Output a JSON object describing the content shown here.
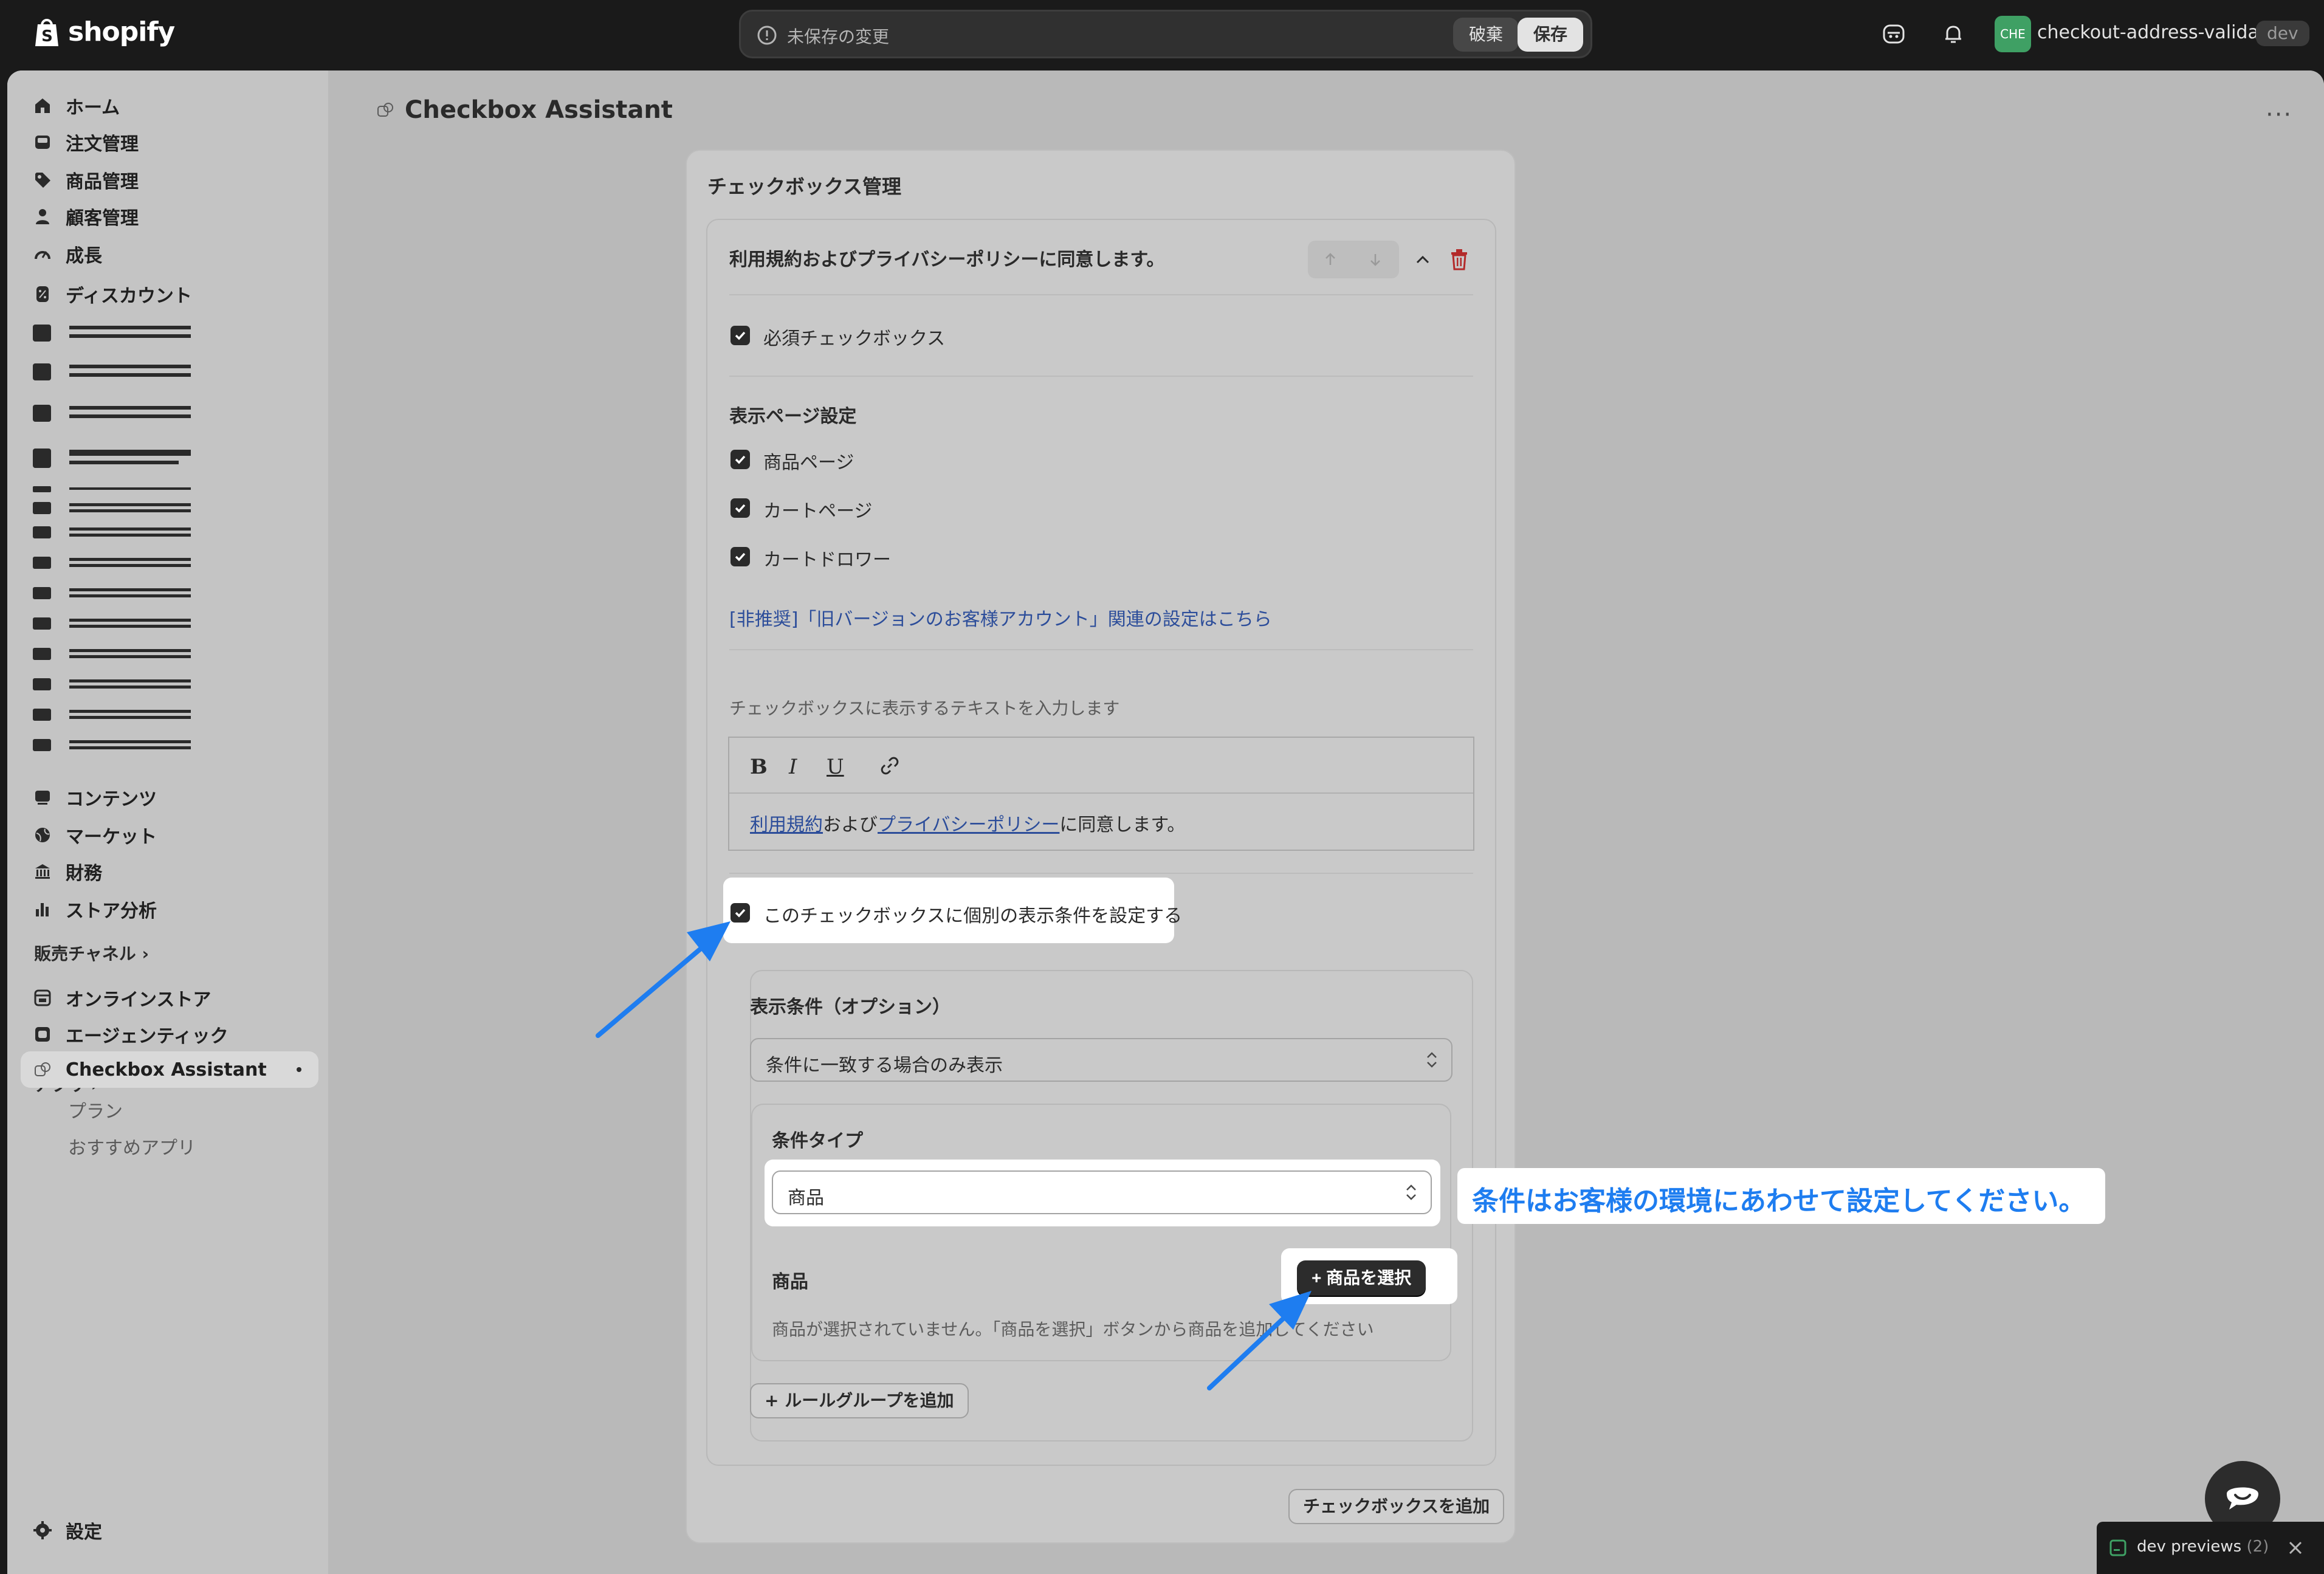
{
  "topbar": {
    "brand": "shopify",
    "unsaved_text": "未保存の変更",
    "discard_label": "破棄",
    "save_label": "保存",
    "store_initials": "CHE",
    "store_name": "checkout-address-valida...",
    "store_tag": "dev"
  },
  "sidebar": {
    "items": [
      {
        "label": "ホーム"
      },
      {
        "label": "注文管理"
      },
      {
        "label": "商品管理"
      },
      {
        "label": "顧客管理"
      },
      {
        "label": "成長"
      },
      {
        "label": "ディスカウント"
      }
    ],
    "items2": [
      {
        "label": "コンテンツ"
      },
      {
        "label": "マーケット"
      },
      {
        "label": "財務"
      },
      {
        "label": "ストア分析"
      }
    ],
    "sales_channels_label": "販売チャネル",
    "channels": [
      {
        "label": "オンラインストア"
      },
      {
        "label": "エージェンティック"
      }
    ],
    "apps_label": "アプリ",
    "app_active": "Checkbox Assistant",
    "app_subitems": [
      "プラン",
      "おすすめアプリ"
    ],
    "settings_label": "設定"
  },
  "page": {
    "title": "Checkbox Assistant",
    "more": "···"
  },
  "card": {
    "title": "チェックボックス管理",
    "item_title": "利用規約およびプライバシーポリシーに同意します。",
    "required_label": "必須チェックボックス",
    "display_section": "表示ページ設定",
    "pages": [
      "商品ページ",
      "カートページ",
      "カートドロワー"
    ],
    "legacy_link": "[非推奨]「旧バージョンのお客様アカウント」関連の設定はこちら",
    "text_hint": "チェックボックスに表示するテキストを入力します",
    "editor": {
      "tools": [
        "B",
        "I",
        "U"
      ],
      "link1": "利用規約",
      "mid": "および",
      "link2": "プライバシーポリシー",
      "tail": "に同意します。"
    },
    "individual_label": "このチェックボックスに個別の表示条件を設定する",
    "conditions": {
      "title": "表示条件（オプション）",
      "mode_value": "条件に一致する場合のみ表示",
      "type_label": "条件タイプ",
      "type_value": "商品",
      "product_label": "商品",
      "select_button": "商品を選択",
      "empty_hint": "商品が選択されていません。「商品を選択」ボタンから商品を追加してください",
      "add_rule_group": "ルールグループを追加"
    },
    "add_checkbox": "チェックボックスを追加"
  },
  "annotation": {
    "text": "条件はお客様の環境にあわせて設定してください。",
    "color": "#1e7df0"
  },
  "devbar": {
    "label": "dev previews",
    "count": "(2)"
  }
}
